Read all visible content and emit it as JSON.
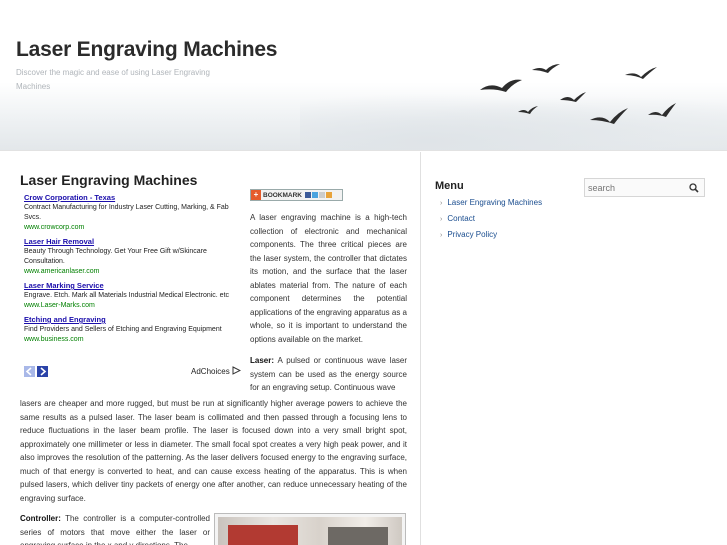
{
  "site": {
    "title": "Laser Engraving Machines",
    "description": "Discover the magic and ease of using Laser Engraving Machines"
  },
  "post": {
    "title": "Laser Engraving Machines",
    "bookmark_label": "BOOKMARK",
    "intro": "A laser engraving machine is a high-tech collection of electronic and mechanical components. The three critical pieces are the laser system, the controller that dictates its motion, and the surface that the laser ablates material from. The nature of each component determines the potential applications of the engraving apparatus as a whole, so it is important to understand the options available on the market.",
    "laser_label": "Laser:",
    "laser_text_a": "A pulsed or continuous wave laser system can be used as the energy source for an engraving setup. Continuous wave",
    "laser_text_b": "lasers are cheaper and more rugged, but must be run at significantly higher average powers to achieve the same results as a pulsed laser. The laser beam is collimated and then passed through a focusing lens to reduce fluctuations in the laser beam profile. The laser is focused down into a very small bright spot, approximately one millimeter or less in diameter. The small focal spot creates a very high peak power, and it also improves the resolution of the patterning. As the laser delivers focused energy to the engraving surface, much of that energy is converted to heat, and can cause excess heating of the apparatus. This is when pulsed lasers, which deliver tiny packets of energy one after another, can reduce unnecessary heating of the engraving surface.",
    "controller_label": "Controller:",
    "controller_text": "The controller is a computer-controlled series of motors that move either the laser or engraving surface in the x and y directions. The"
  },
  "ads": {
    "items": [
      {
        "title": "Crow Corporation - Texas",
        "desc": "Contract Manufacturing for Industry Laser Cutting, Marking, & Fab Svcs.",
        "url": "www.crowcorp.com"
      },
      {
        "title": "Laser Hair Removal",
        "desc": "Beauty Through Technology. Get Your Free Gift w/Skincare Consultation.",
        "url": "www.americanlaser.com"
      },
      {
        "title": "Laser Marking Service",
        "desc": "Engrave. Etch. Mark all Materials Industrial Medical Electronic. etc",
        "url": "www.Laser-Marks.com"
      },
      {
        "title": "Etching and Engraving",
        "desc": "Find Providers and Sellers of Etching and Engraving Equipment",
        "url": "www.business.com"
      }
    ],
    "adchoices": "AdChoices"
  },
  "sidebar": {
    "menu_title": "Menu",
    "items": [
      "Laser Engraving Machines",
      "Contact",
      "Privacy Policy"
    ],
    "search_placeholder": "search"
  },
  "colors": {
    "link": "#1a4d8f",
    "ad_title": "#1a0dab",
    "ad_url": "#008000"
  }
}
